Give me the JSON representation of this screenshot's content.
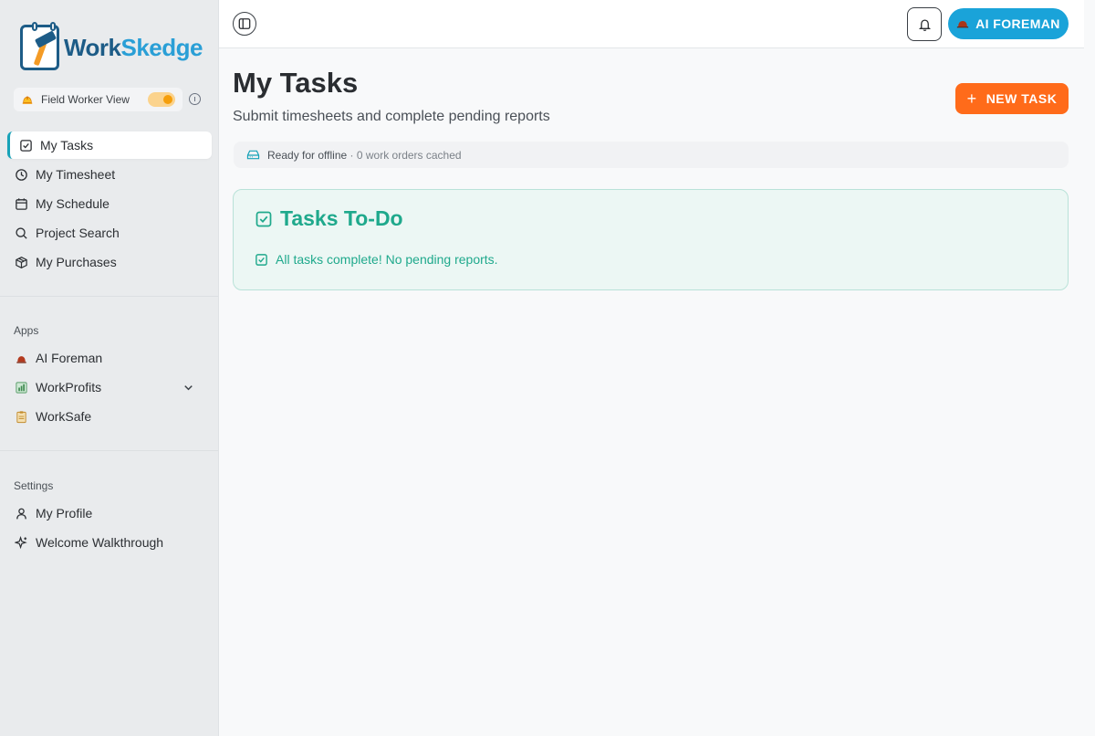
{
  "brand": {
    "part1": "Work",
    "part2": "Skedge"
  },
  "view_toggle": {
    "label": "Field Worker View",
    "on": true
  },
  "nav": {
    "items": [
      {
        "label": "My Tasks",
        "icon": "check-square-icon",
        "active": true
      },
      {
        "label": "My Timesheet",
        "icon": "clock-icon"
      },
      {
        "label": "My Schedule",
        "icon": "calendar-icon"
      },
      {
        "label": "Project Search",
        "icon": "search-icon"
      },
      {
        "label": "My Purchases",
        "icon": "package-icon"
      }
    ]
  },
  "apps": {
    "label": "Apps",
    "items": [
      {
        "label": "AI Foreman",
        "icon": "hardhat-icon"
      },
      {
        "label": "WorkProfits",
        "icon": "chart-icon"
      },
      {
        "label": "WorkSafe",
        "icon": "clipboard-icon"
      }
    ]
  },
  "settings": {
    "label": "Settings",
    "items": [
      {
        "label": "My Profile",
        "icon": "user-icon"
      },
      {
        "label": "Welcome Walkthrough",
        "icon": "sparkle-icon"
      }
    ]
  },
  "header": {
    "ai_button": "AI FOREMAN"
  },
  "page": {
    "title": "My Tasks",
    "subtitle": "Submit timesheets and complete pending reports",
    "new_task_button": "NEW TASK"
  },
  "offline": {
    "status": "Ready for offline",
    "detail": "· 0 work orders cached"
  },
  "tasks_card": {
    "title": "Tasks To-Do",
    "message": "All tasks complete! No pending reports."
  },
  "colors": {
    "accent_teal": "#17a2b8",
    "ai_blue": "#1aa3d9",
    "new_task_orange": "#ff6b1a",
    "success_green": "#1fa98c",
    "toggle_orange": "#f59e0b"
  }
}
